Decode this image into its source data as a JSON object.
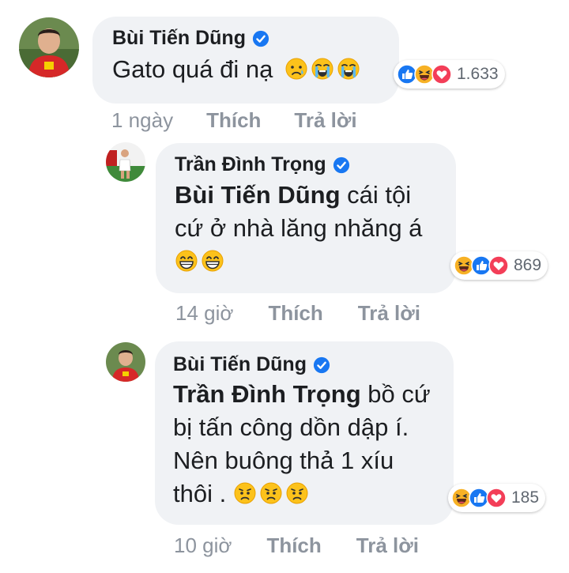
{
  "colors": {
    "bubble": "#f0f2f5",
    "meta": "#8d949e",
    "like": "#1877f2",
    "love": "#f33e58",
    "haha": "#f7b125"
  },
  "comments": [
    {
      "author": "Bùi Tiến Dũng",
      "verified_icon": "verified-badge-icon",
      "text": "Gato quá đi nạ",
      "emojis": [
        "sad-tear-emoji",
        "loudly-crying-emoji",
        "loudly-crying-emoji"
      ],
      "reactions": [
        "like",
        "haha",
        "love"
      ],
      "reaction_count": "1.633",
      "time": "1 ngày",
      "like_label": "Thích",
      "reply_label": "Trả lời"
    },
    {
      "author": "Trần Đình Trọng",
      "verified_icon": "verified-badge-icon",
      "mention": "Bùi Tiến Dũng",
      "text_line1": " cái tội",
      "text_line2": "cứ ở nhà lăng nhăng á",
      "emojis": [
        "grinning-emoji",
        "grinning-emoji"
      ],
      "reactions": [
        "haha",
        "like",
        "love"
      ],
      "reaction_count": "869",
      "time": "14 giờ",
      "like_label": "Thích",
      "reply_label": "Trả lời"
    },
    {
      "author": "Bùi Tiến Dũng",
      "verified_icon": "verified-badge-icon",
      "mention": "Trần Đình Trọng",
      "text_line1": " bồ cứ",
      "text_line2": "bị tấn công dồn dập í.",
      "text_line3": "Nên buông thả 1 xíu",
      "text_line4": "thôi . ",
      "emojis": [
        "frowning-emoji",
        "frowning-emoji",
        "frowning-emoji"
      ],
      "reactions": [
        "haha",
        "like",
        "love"
      ],
      "reaction_count": "185",
      "time": "10 giờ",
      "like_label": "Thích",
      "reply_label": "Trả lời"
    }
  ]
}
